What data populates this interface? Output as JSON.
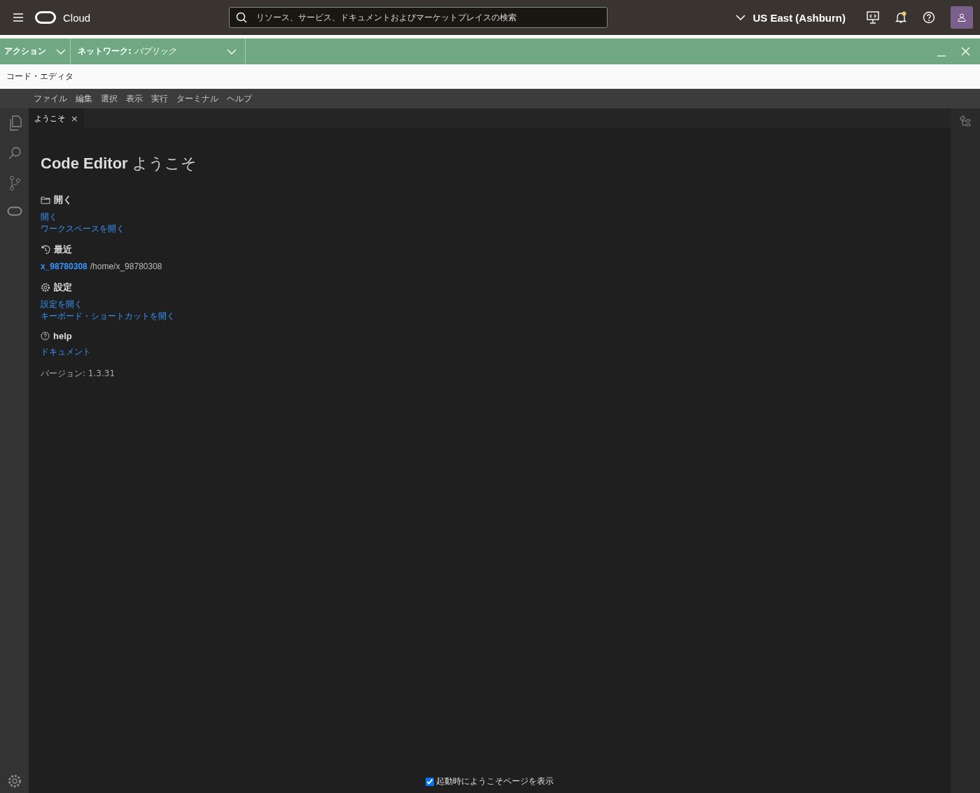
{
  "header": {
    "title": "Cloud",
    "search": {
      "placeholder": "リソース、サービス、ドキュメントおよびマーケットプレイスの検索"
    },
    "region": "US East (Ashburn)"
  },
  "action_bar": {
    "actions": "アクション",
    "network_label": "ネットワーク:",
    "network_value": "パブリック"
  },
  "panel_title": "コード・エディタ",
  "menu": [
    "ファイル",
    "編集",
    "選択",
    "表示",
    "実行",
    "ターミナル",
    "ヘルプ"
  ],
  "tabs": [
    {
      "label": "ようこそ",
      "selected": true,
      "close": "×"
    }
  ],
  "welcome": {
    "title": "**Code Editor** ようこそ",
    "sections": [
      {
        "kind": "open",
        "heading": "開く",
        "links": [
          "開く",
          "ワークスペースを開く"
        ]
      },
      {
        "kind": "recent",
        "heading": "最近",
        "items": [
          {
            "name": "x_98780308",
            "path": "/home/x_98780308"
          }
        ]
      },
      {
        "kind": "settings",
        "heading": "設定",
        "links": [
          "設定を開く",
          "キーボード・ショートカットを開く"
        ]
      },
      {
        "kind": "help",
        "heading": "help",
        "links": [
          "ドキュメント"
        ]
      }
    ],
    "version": "バージョン: 1.3.31"
  },
  "startup_checkbox": {
    "label": "起動時にようこそページを表示",
    "checked": true
  }
}
